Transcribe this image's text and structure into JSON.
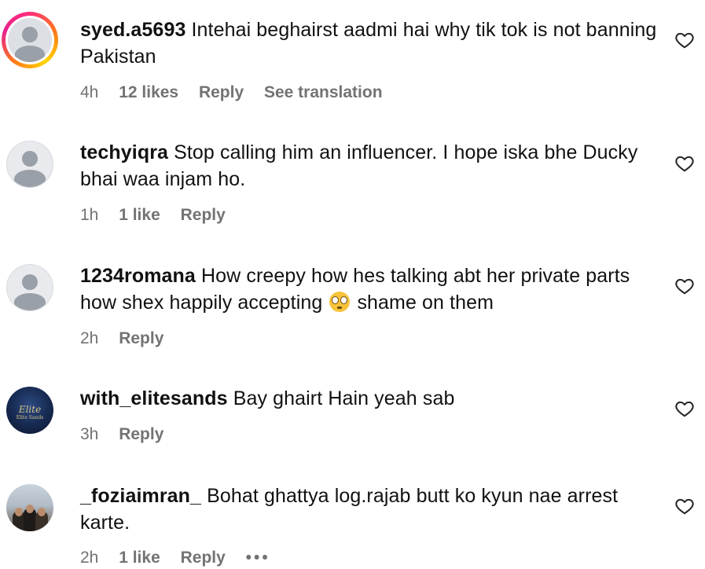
{
  "comments": [
    {
      "username": "syed.a5693",
      "text": "Intehai beghairst aadmi hai why tik tok is not banning Pakistan",
      "time": "4h",
      "likes": "12 likes",
      "reply": "Reply",
      "translate": "See translation",
      "avatar": "default-avatar-with-story-ring"
    },
    {
      "username": "techyiqra",
      "text": "Stop calling him an influencer. I hope iska bhe Ducky bhai waa injam ho.",
      "time": "1h",
      "likes": "1 like",
      "reply": "Reply",
      "avatar": "default-avatar"
    },
    {
      "username": "1234romana",
      "text_before": "How creepy how hes talking abt her private parts how shex happily accepting",
      "emoji": "flushed-face-emoji",
      "text_after": "shame on them",
      "time": "2h",
      "reply": "Reply",
      "avatar": "default-avatar"
    },
    {
      "username": "with_elitesands",
      "text": "Bay ghairt Hain yeah sab",
      "time": "3h",
      "reply": "Reply",
      "avatar": "elite-sands-logo-avatar",
      "avatar_logo": "Elite",
      "avatar_logo_sub": "Elite Sands"
    },
    {
      "username": "_foziaimran_",
      "text": "Bohat ghattya log.rajab butt ko kyun nae arrest karte.",
      "time": "2h",
      "likes": "1 like",
      "reply": "Reply",
      "more": "•••",
      "avatar": "group-photo-avatar"
    }
  ],
  "icons": {
    "like": "heart-outline-icon"
  },
  "colors": {
    "meta_text": "#737373",
    "heart_stroke": "#262626"
  }
}
